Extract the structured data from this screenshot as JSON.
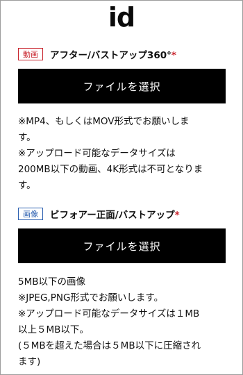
{
  "logo_text": "id",
  "sections": [
    {
      "tag": "動画",
      "title": "アフター/バストアップ360°",
      "required_mark": "*",
      "button_label": "ファイルを選択",
      "notes": [
        "※MP4、もしくはMOV形式でお願いしま",
        "す。",
        "※アップロード可能なデータサイズは",
        "200MB以下の動画、4K形式は不可となりま",
        "す。"
      ]
    },
    {
      "tag": "画像",
      "title": "ビフォアー正面/バストアップ",
      "required_mark": "*",
      "button_label": "ファイルを選択",
      "notes": [
        "5MB以下の画像",
        "※JPEG,PNG形式でお願いします。",
        "※アップロード可能なデータサイズは１MB",
        "以上５MB以下。",
        "(５MBを超えた場合は５MB以下に圧縮され",
        "ます)"
      ]
    }
  ],
  "colors": {
    "video_tag": "#c8242d",
    "image_tag": "#2b5fb0",
    "required": "#c8242d",
    "button_bg": "#000000",
    "button_text": "#ffffff"
  }
}
